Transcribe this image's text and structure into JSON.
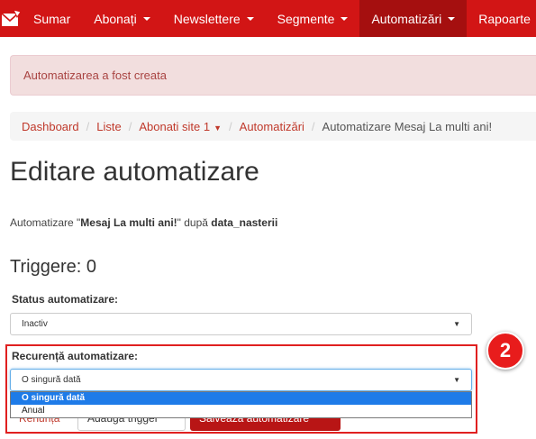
{
  "navbar": {
    "items": [
      {
        "label": "Sumar",
        "caret": false
      },
      {
        "label": "Abonați",
        "caret": true
      },
      {
        "label": "Newslettere",
        "caret": true
      },
      {
        "label": "Segmente",
        "caret": true
      },
      {
        "label": "Automatizări",
        "caret": true,
        "active": true
      },
      {
        "label": "Rapoarte",
        "caret": true
      }
    ]
  },
  "alert": {
    "text": "Automatizarea a fost creata"
  },
  "breadcrumb": {
    "items": [
      "Dashboard",
      "Liste",
      "Abonati site 1",
      "Automatizări",
      "Automatizare Mesaj La multi ani!"
    ]
  },
  "page": {
    "title": "Editare automatizare",
    "subtitle_prefix": "Automatizare \"",
    "subtitle_name": "Mesaj La multi ani!",
    "subtitle_mid": "\" după ",
    "subtitle_field": "data_nasterii",
    "triggers_heading": "Triggere: 0"
  },
  "form": {
    "status_label": "Status automatizare:",
    "status_value": "Inactiv",
    "recurrence_label": "Recurență automatizare:",
    "recurrence_value": "O singură dată",
    "recurrence_options": [
      "O singură dată",
      "Anual"
    ]
  },
  "buttons": {
    "cancel": "Renunță",
    "add_trigger": "Adaugă trigger",
    "save": "Salvează automatizare"
  },
  "annotation": {
    "step": "2"
  },
  "colors": {
    "brand": "#d21515",
    "active_nav": "#a50f0f",
    "highlight": "#e02020",
    "selected_option": "#1e7be8"
  }
}
